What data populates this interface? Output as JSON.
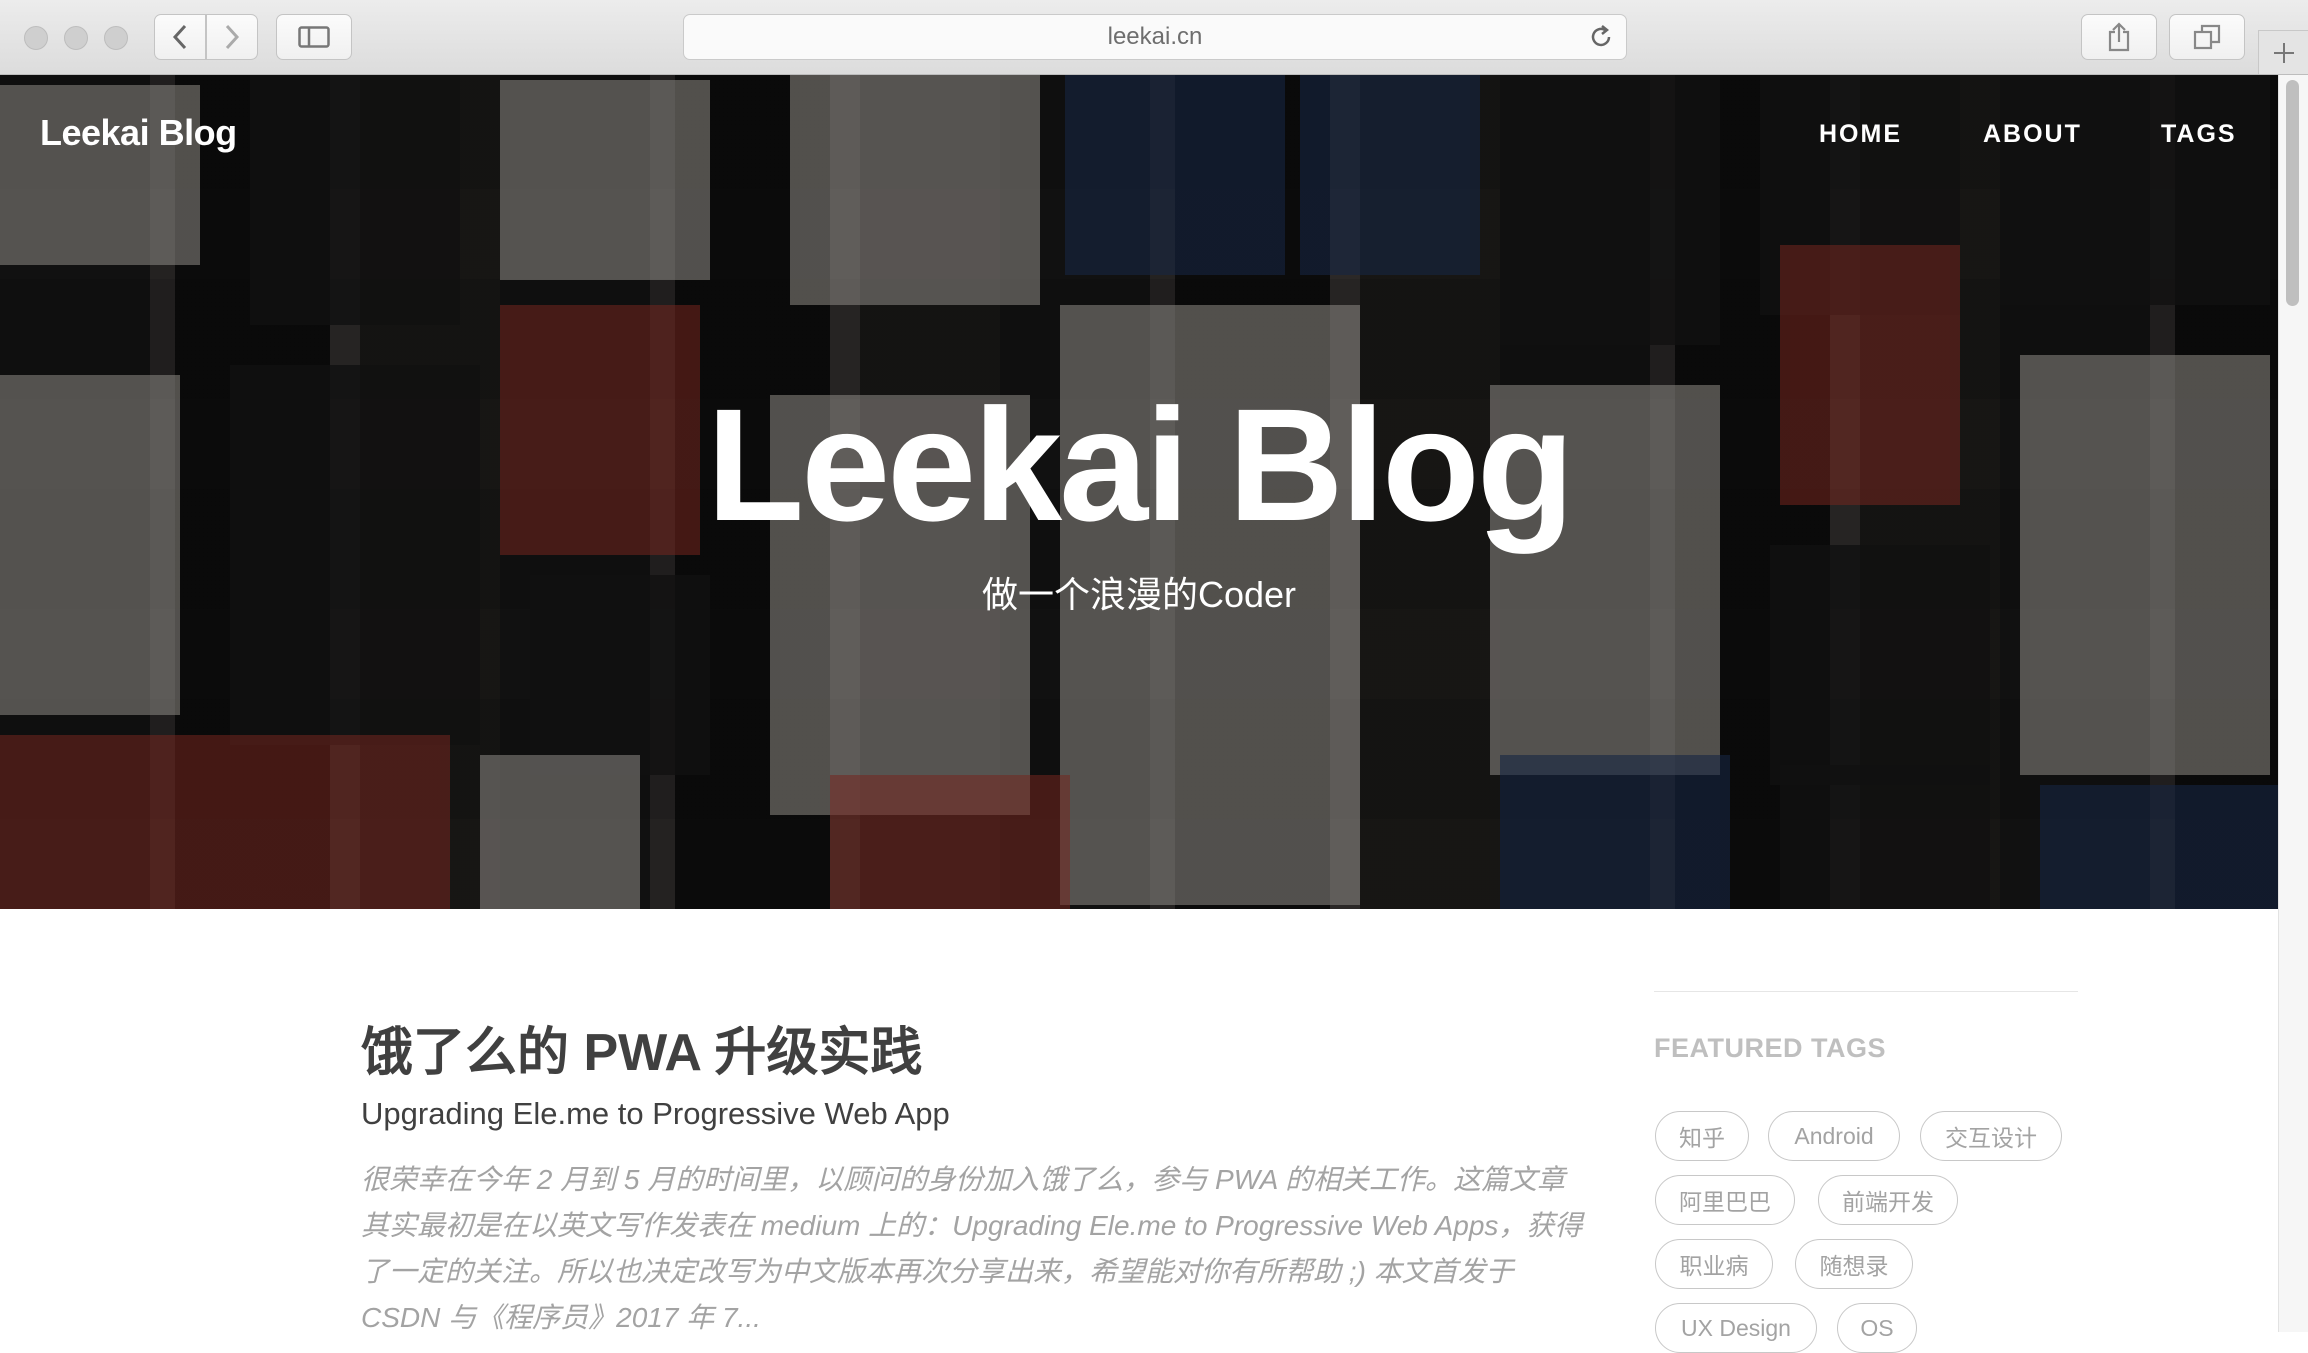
{
  "browser": {
    "url": "leekai.cn"
  },
  "site": {
    "brand": "Leekai Blog",
    "nav": [
      "HOME",
      "ABOUT",
      "TAGS"
    ],
    "hero_title": "Leekai Blog",
    "hero_subtitle": "做一个浪漫的Coder"
  },
  "post": {
    "title": "饿了么的 PWA 升级实践",
    "subtitle": "Upgrading Ele.me to Progressive Web App",
    "excerpt": "很荣幸在今年 2 月到 5 月的时间里，以顾问的身份加入饿了么，参与 PWA 的相关工作。这篇文章其实最初是在以英文写作发表在 medium 上的：Upgrading Ele.me to Progressive Web Apps，获得了一定的关注。所以也决定改写为中文版本再次分享出来，希望能对你有所帮助 ;) 本文首发于 CSDN 与《程序员》2017 年 7..."
  },
  "sidebar": {
    "featured_title": "FEATURED TAGS",
    "tags": [
      "知乎",
      "Android",
      "交互设计",
      "阿里巴巴",
      "前端开发",
      "职业病",
      "随想录",
      "UX Design",
      "OS"
    ]
  }
}
